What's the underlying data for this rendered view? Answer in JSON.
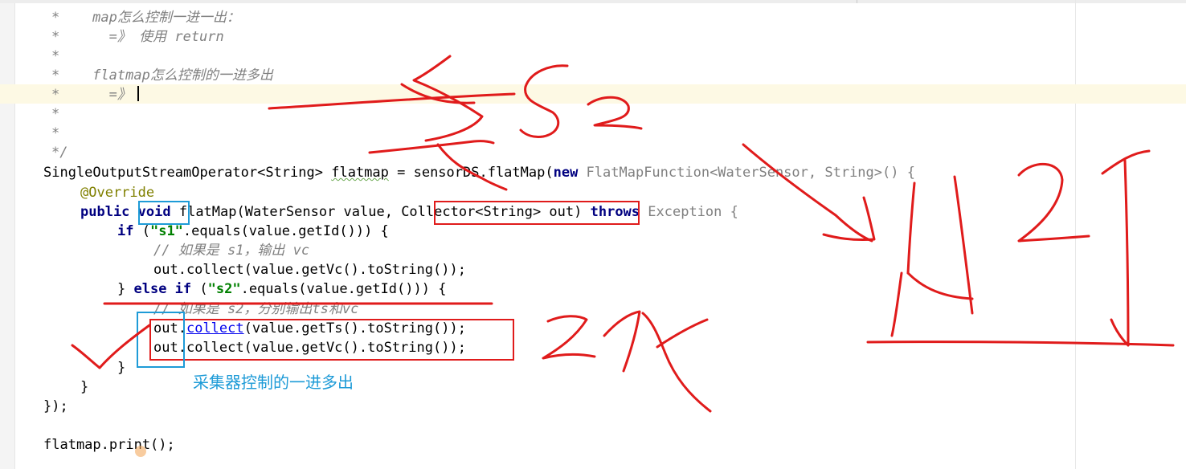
{
  "editor": {
    "comment_lines": [
      "*    map怎么控制一进一出：",
      "*      =》 使用 return",
      "*",
      "*    flatmap怎么控制的一进多出",
      "*      =》",
      "*",
      "*",
      "*/"
    ],
    "code": {
      "decl_prefix": "SingleOutputStreamOperator<String> ",
      "decl_var": "flatmap",
      "decl_mid": " = sensorDS.flatMap(",
      "decl_new": "new ",
      "decl_type": "FlatMapFunction<WaterSensor, String>() {",
      "override": "@Override",
      "public": "public ",
      "void": "void",
      "method_sig": " flatMap(WaterSensor value, ",
      "collector_param": "Collector<String> out",
      "sig_close": ") ",
      "throws": "throws ",
      "exception": "Exception {",
      "if_kw": "if",
      "if_open": " (",
      "s1": "\"s1\"",
      "if_rest": ".equals(value.getId())) {",
      "comment_s1": "// 如果是 s1，输出 vc",
      "collect_vc_1": "out.collect(value.getVc().toString());",
      "else_open": "} ",
      "else_kw": "else if",
      "else_paren": " (",
      "s2": "\"s2\"",
      "else_rest": ".equals(value.getId())) {",
      "comment_s2": "// 如果是 s2，分别输出ts和vc",
      "out_1": "out",
      "dot_1": ".",
      "collect_link": "collect",
      "collect_ts_rest": "(value.getTs().toString());",
      "out_2": "out",
      "collect_vc_2_rest": ".collect(value.getVc().toString());",
      "brace_if": "}",
      "brace_method": "}",
      "brace_class": "});",
      "print_line": "flatmap.print();"
    }
  },
  "annotations": {
    "blue_note": "采集器控制的一进多出",
    "ink_color": "#e01b1b",
    "box_blue_color": "#1e9bd7"
  }
}
